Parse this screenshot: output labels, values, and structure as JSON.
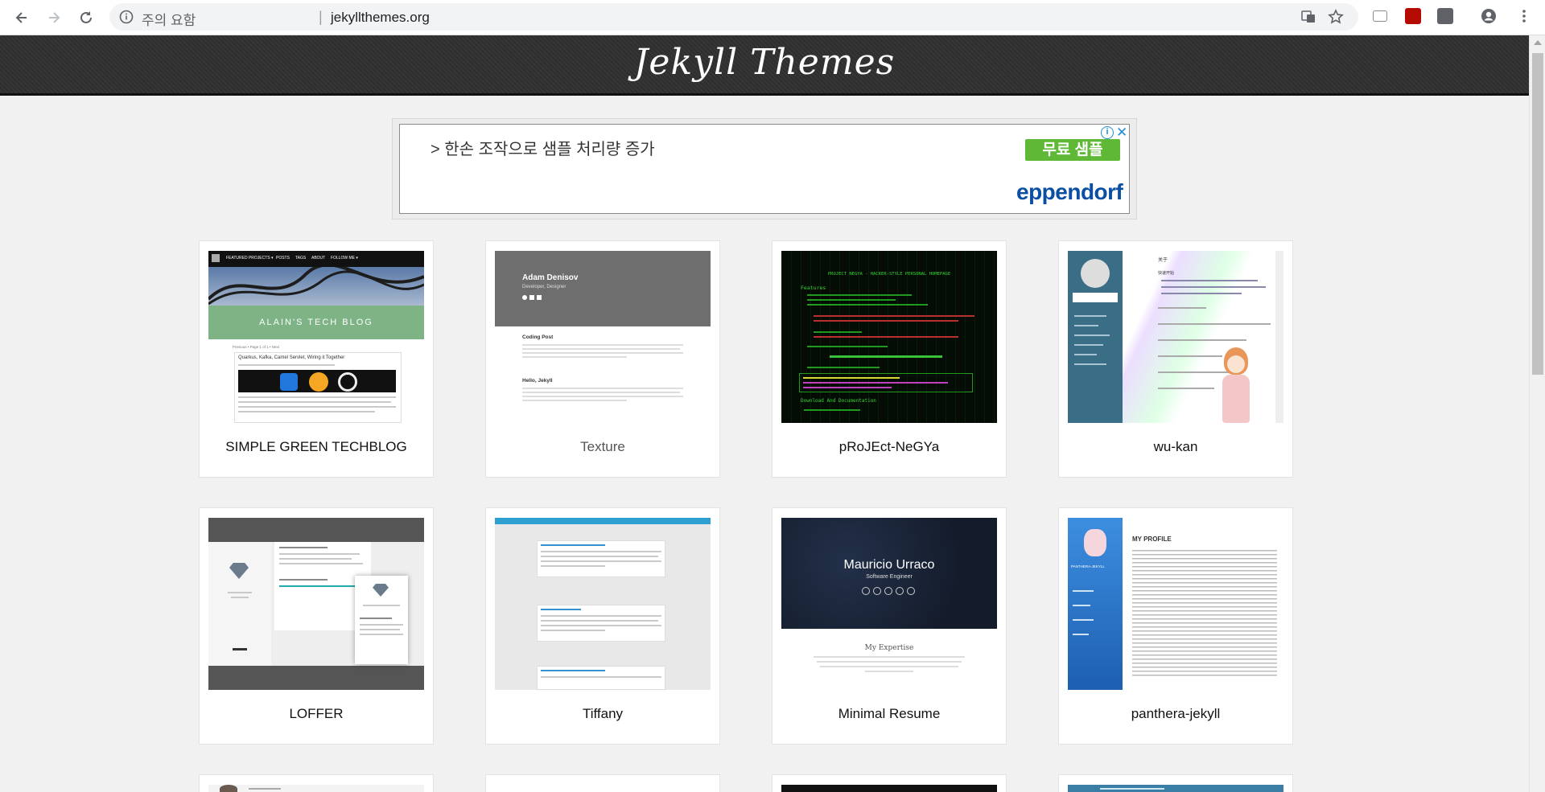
{
  "browser": {
    "security_warning": "주의 요함",
    "separator": "|",
    "url": "jekyllthemes.org"
  },
  "site": {
    "title": "Jekyll Themes"
  },
  "ad": {
    "headline": "> 한손 조작으로 샘플 처리량 증가",
    "cta": "무료 샘플",
    "brand": "eppendorf",
    "info": "i",
    "close": "✕"
  },
  "themes": [
    {
      "name": "SIMPLE GREEN TECHBLOG",
      "preview": {
        "nav": [
          "FEATURED PROJECTS ▾",
          "POSTS",
          "TAGS",
          "ABOUT",
          "FOLLOW ME ▾"
        ],
        "banner": "ALAIN'S TECH BLOG",
        "pager": "Previous • Page 1 of 1 • Next",
        "post_title": "Quarkus, Kafka, Camel Servlet, Wiring it Together"
      }
    },
    {
      "name": "Texture",
      "preview": {
        "author": "Adam Denisov",
        "role": "Developer, Designer",
        "post1": "Coding Post",
        "post2": "Hello, Jekyll"
      }
    },
    {
      "name": "pRoJEct-NeGYa",
      "preview": {
        "heading": "PROJECT NEGYA - HACKER-STYLE PERSONAL HOMEPAGE",
        "features": "Features",
        "download": "Download And Documentation"
      }
    },
    {
      "name": "wu-kan",
      "preview": {
        "heading": "关于",
        "sub": "快速开始"
      }
    },
    {
      "name": "LOFFER",
      "preview": {}
    },
    {
      "name": "Tiffany",
      "preview": {}
    },
    {
      "name": "Minimal Resume",
      "preview": {
        "person": "Mauricio Urraco",
        "role": "Software Engineer",
        "section": "My Expertise"
      }
    },
    {
      "name": "panthera-jekyll",
      "preview": {
        "heading": "MY PROFILE",
        "sidebar": "PANTHERA-JEKYLL"
      }
    }
  ],
  "colors": {
    "header_bg": "#333333",
    "page_bg": "#f1f1f1",
    "ad_cta": "#5fb936",
    "ad_brand": "#0a4fa3"
  }
}
